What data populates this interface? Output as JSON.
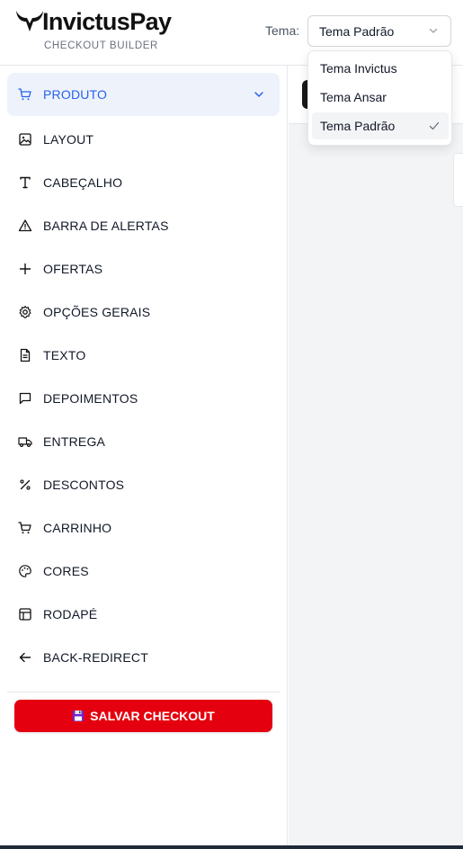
{
  "brand": {
    "name": "InvictusPay",
    "subtitle": "CHECKOUT BUILDER"
  },
  "theme": {
    "label": "Tema:",
    "selected": "Tema Padrão",
    "options": [
      "Tema Invictus",
      "Tema Ansar",
      "Tema Padrão"
    ]
  },
  "sidebar": {
    "items": [
      {
        "label": "PRODUTO",
        "icon": "cart-icon"
      },
      {
        "label": "LAYOUT",
        "icon": "image-icon"
      },
      {
        "label": "CABEÇALHO",
        "icon": "type-icon"
      },
      {
        "label": "BARRA DE ALERTAS",
        "icon": "alert-triangle-icon"
      },
      {
        "label": "OFERTAS",
        "icon": "plus-icon"
      },
      {
        "label": "OPÇÕES GERAIS",
        "icon": "gear-icon"
      },
      {
        "label": "TEXTO",
        "icon": "file-text-icon"
      },
      {
        "label": "DEPOIMENTOS",
        "icon": "message-square-icon"
      },
      {
        "label": "ENTREGA",
        "icon": "truck-icon"
      },
      {
        "label": "DESCONTOS",
        "icon": "percent-icon"
      },
      {
        "label": "CARRINHO",
        "icon": "cart-icon"
      },
      {
        "label": "CORES",
        "icon": "palette-icon"
      },
      {
        "label": "RODAPÉ",
        "icon": "layout-icon"
      },
      {
        "label": "BACK-REDIRECT",
        "icon": "arrow-left-icon"
      }
    ],
    "save_label": "SALVAR CHECKOUT"
  },
  "colors": {
    "accent": "#2563eb",
    "active_bg": "#eef2fb",
    "save": "#e5000f"
  }
}
